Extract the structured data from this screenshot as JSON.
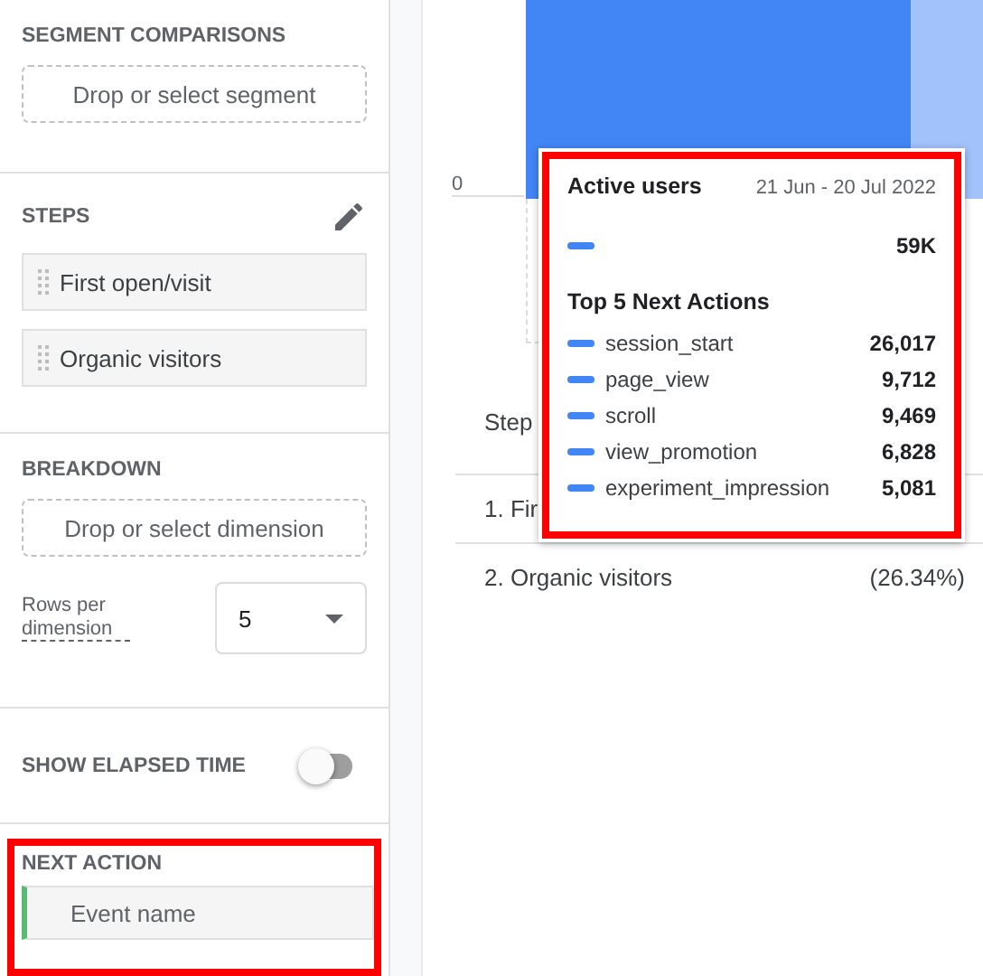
{
  "sidebar": {
    "segment_comparisons": {
      "title": "SEGMENT COMPARISONS",
      "drop_zone": "Drop or select segment"
    },
    "steps": {
      "title": "STEPS",
      "items": [
        "First open/visit",
        "Organic visitors"
      ]
    },
    "breakdown": {
      "title": "BREAKDOWN",
      "drop_zone": "Drop or select dimension",
      "rows_label": "Rows per dimension",
      "rows_value": "5"
    },
    "elapsed_time": {
      "label": "SHOW ELAPSED TIME",
      "on": false
    },
    "next_action": {
      "title": "NEXT ACTION",
      "value": "Event name"
    }
  },
  "chart": {
    "axis_label": "0"
  },
  "table": {
    "header": "Step",
    "rows": [
      {
        "step": "1. Fir",
        "value": ""
      },
      {
        "step": "2. Organic visitors",
        "value": "(26.34%)"
      }
    ]
  },
  "tooltip": {
    "metric": "Active users",
    "date_range": "21 Jun - 20 Jul 2022",
    "total": "59K",
    "section_title": "Top 5 Next Actions",
    "actions": [
      {
        "name": "session_start",
        "value": "26,017"
      },
      {
        "name": "page_view",
        "value": "9,712"
      },
      {
        "name": "scroll",
        "value": "9,469"
      },
      {
        "name": "view_promotion",
        "value": "6,828"
      },
      {
        "name": "experiment_impression",
        "value": "5,081"
      }
    ]
  }
}
